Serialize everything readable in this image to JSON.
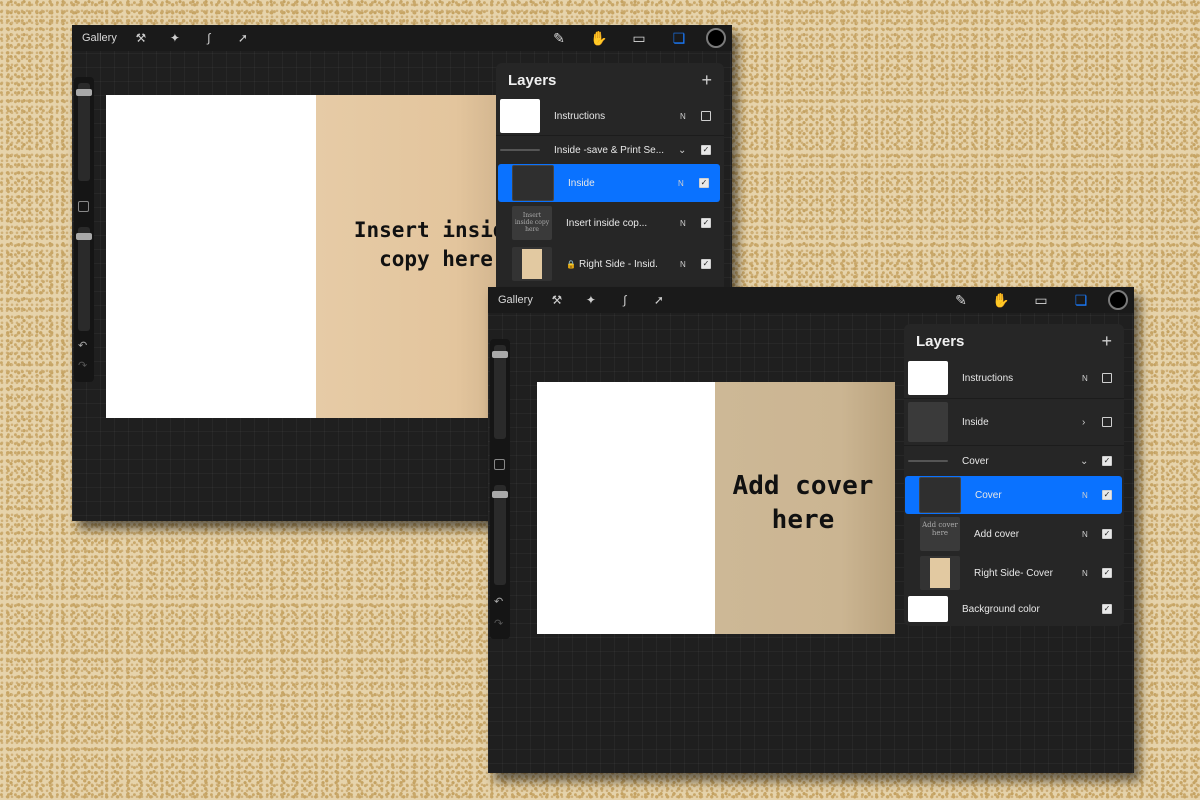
{
  "window_a": {
    "toolbar": {
      "gallery": "Gallery"
    },
    "canvas": {
      "text_line1": "Insert inside",
      "text_line2": "copy here",
      "colors": {
        "left": "#ffffff",
        "right": "#e6cba6"
      }
    },
    "layers": {
      "title": "Layers",
      "add": "+",
      "rows": [
        {
          "name": "Instructions",
          "mode": "N",
          "checked": false
        },
        {
          "name": "Inside -save & Print Se...",
          "checked": true
        },
        {
          "name": "Inside",
          "mode": "N",
          "checked": true,
          "selected": true
        },
        {
          "name": "Insert inside cop...",
          "mode": "N",
          "checked": true,
          "thumb_text": "Insert inside copy here"
        },
        {
          "name": "Right Side - Insid...",
          "mode": "N",
          "checked": true
        }
      ]
    }
  },
  "window_b": {
    "toolbar": {
      "gallery": "Gallery"
    },
    "canvas": {
      "text_line1": "Add cover",
      "text_line2": "here",
      "colors": {
        "left": "#ffffff",
        "right": "#cdb896"
      }
    },
    "layers": {
      "title": "Layers",
      "add": "+",
      "rows": [
        {
          "name": "Instructions",
          "mode": "N",
          "checked": false
        },
        {
          "name": "Inside",
          "checked": false
        },
        {
          "name": "Cover",
          "checked": true
        },
        {
          "name": "Cover",
          "mode": "N",
          "checked": true,
          "selected": true
        },
        {
          "name": "Add cover",
          "mode": "N",
          "checked": true,
          "thumb_text": "Add cover here"
        },
        {
          "name": "Right Side- Cover",
          "mode": "N",
          "checked": true
        },
        {
          "name": "Background color",
          "checked": true
        }
      ]
    }
  },
  "icons": [
    "wrench-icon",
    "magic-wand-icon",
    "selection-icon",
    "transform-arrow-icon",
    "brush-icon",
    "smudge-icon",
    "eraser-icon",
    "layers-icon",
    "color-swatch-icon",
    "undo-icon",
    "redo-icon"
  ],
  "accent_color": "#0a72ff"
}
